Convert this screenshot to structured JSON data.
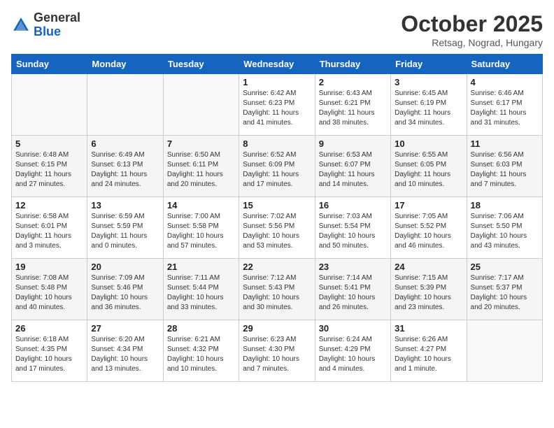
{
  "header": {
    "logo_general": "General",
    "logo_blue": "Blue",
    "title": "October 2025",
    "subtitle": "Retsag, Nograd, Hungary"
  },
  "weekdays": [
    "Sunday",
    "Monday",
    "Tuesday",
    "Wednesday",
    "Thursday",
    "Friday",
    "Saturday"
  ],
  "weeks": [
    [
      {
        "day": "",
        "info": ""
      },
      {
        "day": "",
        "info": ""
      },
      {
        "day": "",
        "info": ""
      },
      {
        "day": "1",
        "info": "Sunrise: 6:42 AM\nSunset: 6:23 PM\nDaylight: 11 hours\nand 41 minutes."
      },
      {
        "day": "2",
        "info": "Sunrise: 6:43 AM\nSunset: 6:21 PM\nDaylight: 11 hours\nand 38 minutes."
      },
      {
        "day": "3",
        "info": "Sunrise: 6:45 AM\nSunset: 6:19 PM\nDaylight: 11 hours\nand 34 minutes."
      },
      {
        "day": "4",
        "info": "Sunrise: 6:46 AM\nSunset: 6:17 PM\nDaylight: 11 hours\nand 31 minutes."
      }
    ],
    [
      {
        "day": "5",
        "info": "Sunrise: 6:48 AM\nSunset: 6:15 PM\nDaylight: 11 hours\nand 27 minutes."
      },
      {
        "day": "6",
        "info": "Sunrise: 6:49 AM\nSunset: 6:13 PM\nDaylight: 11 hours\nand 24 minutes."
      },
      {
        "day": "7",
        "info": "Sunrise: 6:50 AM\nSunset: 6:11 PM\nDaylight: 11 hours\nand 20 minutes."
      },
      {
        "day": "8",
        "info": "Sunrise: 6:52 AM\nSunset: 6:09 PM\nDaylight: 11 hours\nand 17 minutes."
      },
      {
        "day": "9",
        "info": "Sunrise: 6:53 AM\nSunset: 6:07 PM\nDaylight: 11 hours\nand 14 minutes."
      },
      {
        "day": "10",
        "info": "Sunrise: 6:55 AM\nSunset: 6:05 PM\nDaylight: 11 hours\nand 10 minutes."
      },
      {
        "day": "11",
        "info": "Sunrise: 6:56 AM\nSunset: 6:03 PM\nDaylight: 11 hours\nand 7 minutes."
      }
    ],
    [
      {
        "day": "12",
        "info": "Sunrise: 6:58 AM\nSunset: 6:01 PM\nDaylight: 11 hours\nand 3 minutes."
      },
      {
        "day": "13",
        "info": "Sunrise: 6:59 AM\nSunset: 5:59 PM\nDaylight: 11 hours\nand 0 minutes."
      },
      {
        "day": "14",
        "info": "Sunrise: 7:00 AM\nSunset: 5:58 PM\nDaylight: 10 hours\nand 57 minutes."
      },
      {
        "day": "15",
        "info": "Sunrise: 7:02 AM\nSunset: 5:56 PM\nDaylight: 10 hours\nand 53 minutes."
      },
      {
        "day": "16",
        "info": "Sunrise: 7:03 AM\nSunset: 5:54 PM\nDaylight: 10 hours\nand 50 minutes."
      },
      {
        "day": "17",
        "info": "Sunrise: 7:05 AM\nSunset: 5:52 PM\nDaylight: 10 hours\nand 46 minutes."
      },
      {
        "day": "18",
        "info": "Sunrise: 7:06 AM\nSunset: 5:50 PM\nDaylight: 10 hours\nand 43 minutes."
      }
    ],
    [
      {
        "day": "19",
        "info": "Sunrise: 7:08 AM\nSunset: 5:48 PM\nDaylight: 10 hours\nand 40 minutes."
      },
      {
        "day": "20",
        "info": "Sunrise: 7:09 AM\nSunset: 5:46 PM\nDaylight: 10 hours\nand 36 minutes."
      },
      {
        "day": "21",
        "info": "Sunrise: 7:11 AM\nSunset: 5:44 PM\nDaylight: 10 hours\nand 33 minutes."
      },
      {
        "day": "22",
        "info": "Sunrise: 7:12 AM\nSunset: 5:43 PM\nDaylight: 10 hours\nand 30 minutes."
      },
      {
        "day": "23",
        "info": "Sunrise: 7:14 AM\nSunset: 5:41 PM\nDaylight: 10 hours\nand 26 minutes."
      },
      {
        "day": "24",
        "info": "Sunrise: 7:15 AM\nSunset: 5:39 PM\nDaylight: 10 hours\nand 23 minutes."
      },
      {
        "day": "25",
        "info": "Sunrise: 7:17 AM\nSunset: 5:37 PM\nDaylight: 10 hours\nand 20 minutes."
      }
    ],
    [
      {
        "day": "26",
        "info": "Sunrise: 6:18 AM\nSunset: 4:35 PM\nDaylight: 10 hours\nand 17 minutes."
      },
      {
        "day": "27",
        "info": "Sunrise: 6:20 AM\nSunset: 4:34 PM\nDaylight: 10 hours\nand 13 minutes."
      },
      {
        "day": "28",
        "info": "Sunrise: 6:21 AM\nSunset: 4:32 PM\nDaylight: 10 hours\nand 10 minutes."
      },
      {
        "day": "29",
        "info": "Sunrise: 6:23 AM\nSunset: 4:30 PM\nDaylight: 10 hours\nand 7 minutes."
      },
      {
        "day": "30",
        "info": "Sunrise: 6:24 AM\nSunset: 4:29 PM\nDaylight: 10 hours\nand 4 minutes."
      },
      {
        "day": "31",
        "info": "Sunrise: 6:26 AM\nSunset: 4:27 PM\nDaylight: 10 hours\nand 1 minute."
      },
      {
        "day": "",
        "info": ""
      }
    ]
  ]
}
